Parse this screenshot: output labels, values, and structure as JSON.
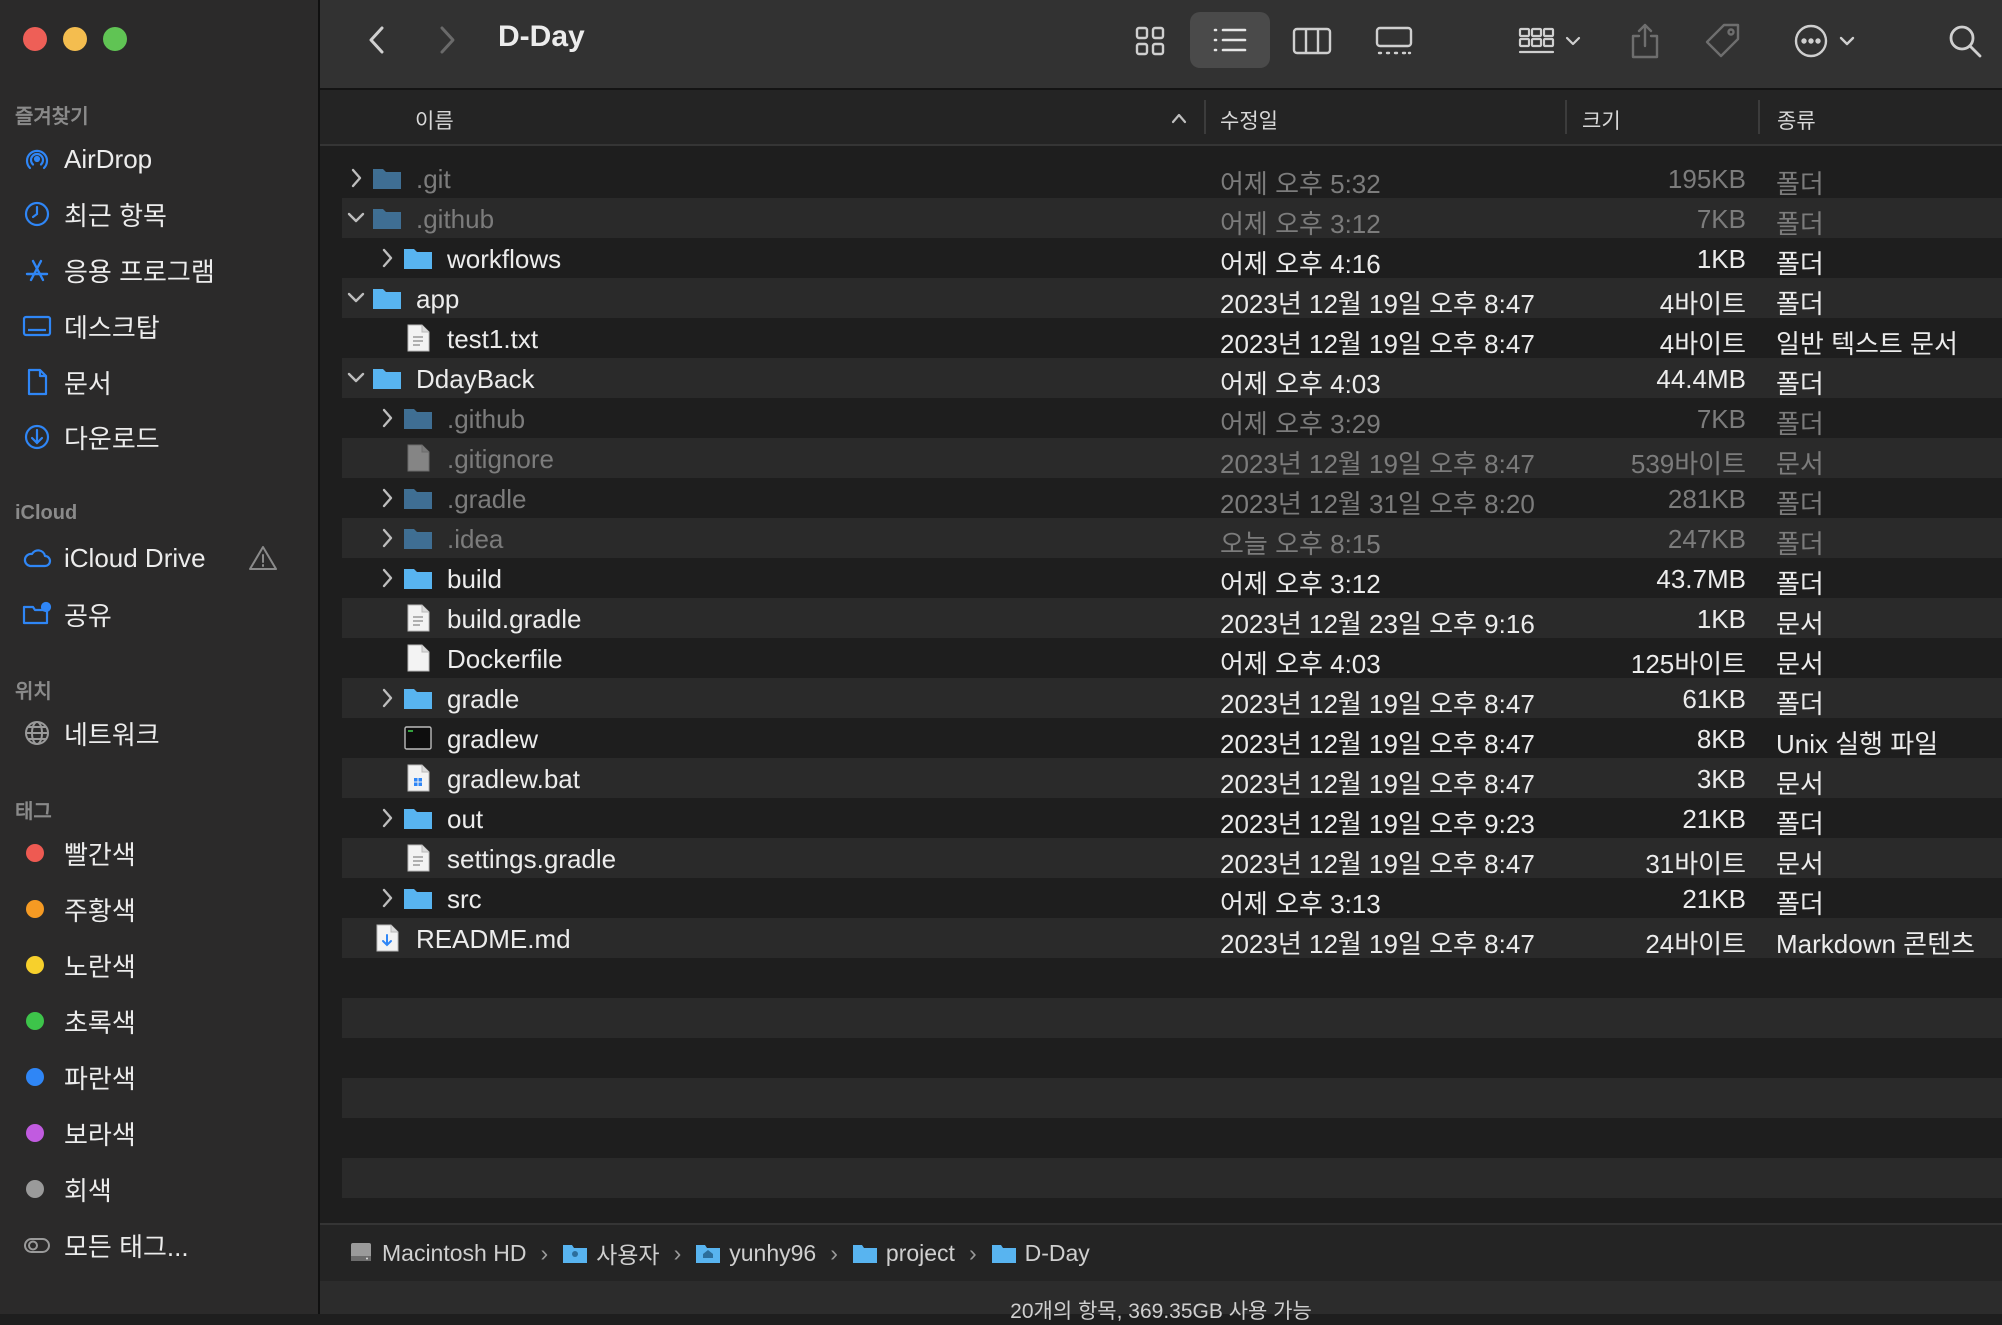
{
  "window": {
    "title": "D-Day"
  },
  "sidebar": {
    "favorites_title": "즐겨찾기",
    "favorites": [
      {
        "label": "AirDrop",
        "icon": "airdrop-icon"
      },
      {
        "label": "최근 항목",
        "icon": "clock-icon"
      },
      {
        "label": "응용 프로그램",
        "icon": "applications-icon"
      },
      {
        "label": "데스크탑",
        "icon": "desktop-icon"
      },
      {
        "label": "문서",
        "icon": "document-icon"
      },
      {
        "label": "다운로드",
        "icon": "download-icon"
      }
    ],
    "icloud_title": "iCloud",
    "icloud": [
      {
        "label": "iCloud Drive",
        "icon": "cloud-icon"
      },
      {
        "label": "공유",
        "icon": "shared-folder-icon"
      }
    ],
    "locations_title": "위치",
    "locations": [
      {
        "label": "네트워크",
        "icon": "network-icon"
      }
    ],
    "tags_title": "태그",
    "tags": [
      {
        "label": "빨간색",
        "color": "#ee5a52"
      },
      {
        "label": "주황색",
        "color": "#f59a23"
      },
      {
        "label": "노란색",
        "color": "#f7d02c"
      },
      {
        "label": "초록색",
        "color": "#3dc44a"
      },
      {
        "label": "파란색",
        "color": "#2f86f6"
      },
      {
        "label": "보라색",
        "color": "#c15be0"
      },
      {
        "label": "회색",
        "color": "#9a9a9a"
      },
      {
        "label": "모든 태그...",
        "color": ""
      }
    ]
  },
  "columns": {
    "name": "이름",
    "modified": "수정일",
    "size": "크기",
    "kind": "종류"
  },
  "files": [
    {
      "name": ".git",
      "date": "어제 오후 5:32",
      "size": "195KB",
      "kind": "폴더",
      "type": "folder",
      "level": 0,
      "expand": "collapsed",
      "hidden": true
    },
    {
      "name": ".github",
      "date": "어제 오후 3:12",
      "size": "7KB",
      "kind": "폴더",
      "type": "folder",
      "level": 0,
      "expand": "expanded",
      "hidden": true
    },
    {
      "name": "workflows",
      "date": "어제 오후 4:16",
      "size": "1KB",
      "kind": "폴더",
      "type": "folder",
      "level": 1,
      "expand": "collapsed",
      "hidden": false
    },
    {
      "name": "app",
      "date": "2023년 12월 19일 오후 8:47",
      "size": "4바이트",
      "kind": "폴더",
      "type": "folder",
      "level": 0,
      "expand": "expanded",
      "hidden": false
    },
    {
      "name": "test1.txt",
      "date": "2023년 12월 19일 오후 8:47",
      "size": "4바이트",
      "kind": "일반 텍스트 문서",
      "type": "text",
      "level": 1,
      "expand": "none",
      "hidden": false
    },
    {
      "name": "DdayBack",
      "date": "어제 오후 4:03",
      "size": "44.4MB",
      "kind": "폴더",
      "type": "folder",
      "level": 0,
      "expand": "expanded",
      "hidden": false
    },
    {
      "name": ".github",
      "date": "어제 오후 3:29",
      "size": "7KB",
      "kind": "폴더",
      "type": "folder",
      "level": 1,
      "expand": "collapsed",
      "hidden": true
    },
    {
      "name": ".gitignore",
      "date": "2023년 12월 19일 오후 8:47",
      "size": "539바이트",
      "kind": "문서",
      "type": "blank",
      "level": 1,
      "expand": "none",
      "hidden": true
    },
    {
      "name": ".gradle",
      "date": "2023년 12월 31일 오후 8:20",
      "size": "281KB",
      "kind": "폴더",
      "type": "folder",
      "level": 1,
      "expand": "collapsed",
      "hidden": true
    },
    {
      "name": ".idea",
      "date": "오늘 오후 8:15",
      "size": "247KB",
      "kind": "폴더",
      "type": "folder",
      "level": 1,
      "expand": "collapsed",
      "hidden": true
    },
    {
      "name": "build",
      "date": "어제 오후 3:12",
      "size": "43.7MB",
      "kind": "폴더",
      "type": "folder",
      "level": 1,
      "expand": "collapsed",
      "hidden": false
    },
    {
      "name": "build.gradle",
      "date": "2023년 12월 23일 오후 9:16",
      "size": "1KB",
      "kind": "문서",
      "type": "text",
      "level": 1,
      "expand": "none",
      "hidden": false
    },
    {
      "name": "Dockerfile",
      "date": "어제 오후 4:03",
      "size": "125바이트",
      "kind": "문서",
      "type": "blank",
      "level": 1,
      "expand": "none",
      "hidden": false
    },
    {
      "name": "gradle",
      "date": "2023년 12월 19일 오후 8:47",
      "size": "61KB",
      "kind": "폴더",
      "type": "folder",
      "level": 1,
      "expand": "collapsed",
      "hidden": false
    },
    {
      "name": "gradlew",
      "date": "2023년 12월 19일 오후 8:47",
      "size": "8KB",
      "kind": "Unix 실행 파일",
      "type": "exec",
      "level": 1,
      "expand": "none",
      "hidden": false
    },
    {
      "name": "gradlew.bat",
      "date": "2023년 12월 19일 오후 8:47",
      "size": "3KB",
      "kind": "문서",
      "type": "bat",
      "level": 1,
      "expand": "none",
      "hidden": false
    },
    {
      "name": "out",
      "date": "2023년 12월 19일 오후 9:23",
      "size": "21KB",
      "kind": "폴더",
      "type": "folder",
      "level": 1,
      "expand": "collapsed",
      "hidden": false
    },
    {
      "name": "settings.gradle",
      "date": "2023년 12월 19일 오후 8:47",
      "size": "31바이트",
      "kind": "문서",
      "type": "text",
      "level": 1,
      "expand": "none",
      "hidden": false
    },
    {
      "name": "src",
      "date": "어제 오후 3:13",
      "size": "21KB",
      "kind": "폴더",
      "type": "folder",
      "level": 1,
      "expand": "collapsed",
      "hidden": false
    },
    {
      "name": "README.md",
      "date": "2023년 12월 19일 오후 8:47",
      "size": "24바이트",
      "kind": "Markdown 콘텐츠",
      "type": "markdown",
      "level": 0,
      "expand": "none",
      "hidden": false
    }
  ],
  "path": [
    "Macintosh HD",
    "사용자",
    "yunhy96",
    "project",
    "D-Day"
  ],
  "status": "20개의 항목, 369.35GB 사용 가능",
  "colors": {
    "folder": "#58b4f0",
    "folder_dim": "#3f6f93",
    "accent": "#2f86f6"
  }
}
